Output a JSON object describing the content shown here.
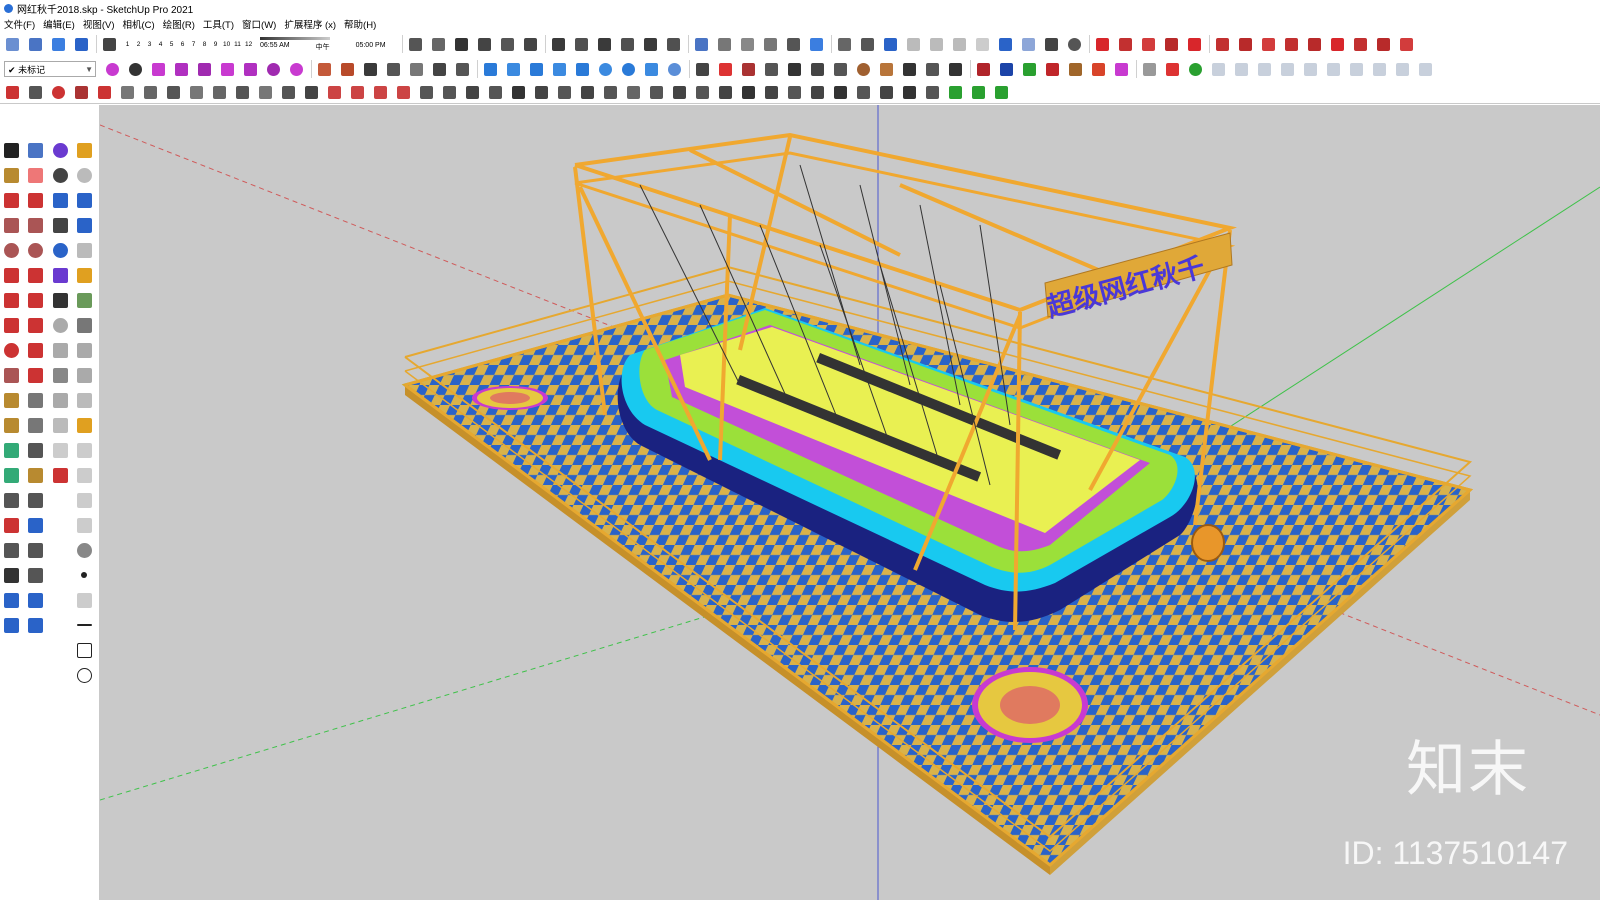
{
  "window": {
    "title": "网红秋千2018.skp - SketchUp Pro 2021"
  },
  "menu": [
    "文件(F)",
    "编辑(E)",
    "视图(V)",
    "相机(C)",
    "绘图(R)",
    "工具(T)",
    "窗口(W)",
    "扩展程序 (x)",
    "帮助(H)"
  ],
  "shadow": {
    "months": [
      "1",
      "2",
      "3",
      "4",
      "5",
      "6",
      "7",
      "8",
      "9",
      "10",
      "11",
      "12"
    ],
    "time_start": "06:55 AM",
    "time_mid": "中午",
    "time_end": "05:00 PM"
  },
  "tag": {
    "current": "未标记",
    "check": "✔"
  },
  "model": {
    "sign_text": "超级网红秋千"
  },
  "watermark": {
    "brand": "知末",
    "id_text": "ID: 1137510147"
  },
  "colors": {
    "viewport_bg": "#c9c9c9",
    "frame_orange": "#f0a830",
    "checker_blue": "#2a63c8",
    "checker_yellow": "#d9b24a",
    "pool_navy": "#1a2280",
    "pool_cyan": "#18c9f0",
    "pool_lime": "#9be03a",
    "pool_magenta": "#c24fd8",
    "trampoline_red": "#e07a5f"
  }
}
